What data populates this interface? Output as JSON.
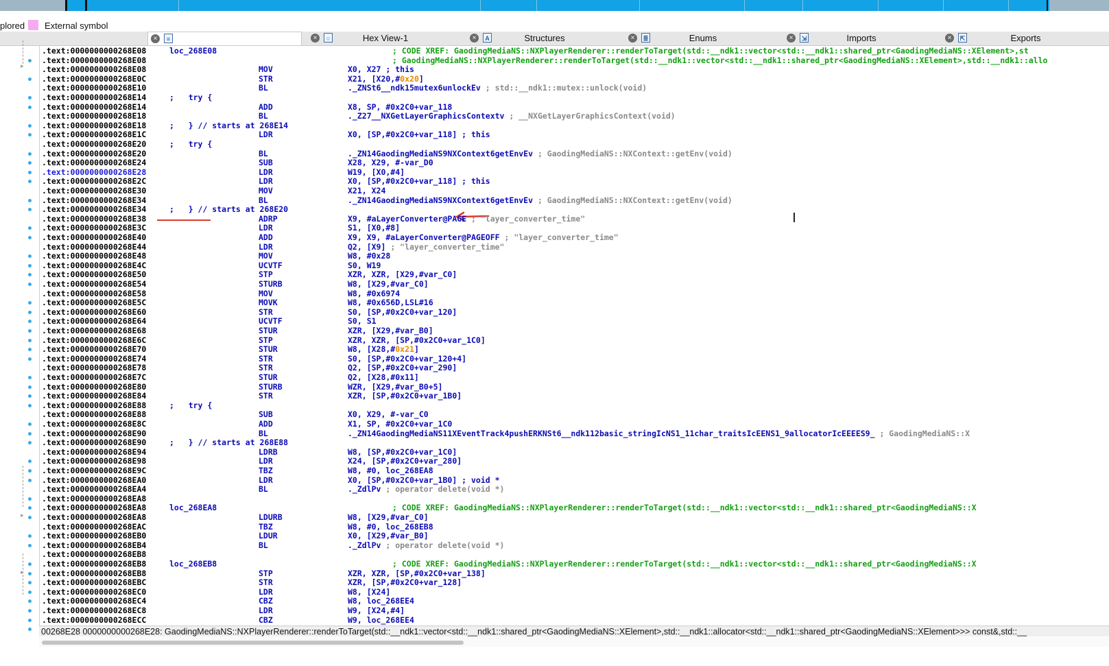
{
  "legend": {
    "explored": "plored",
    "external": "External symbol",
    "external_color": "#f7aaf2"
  },
  "tabs": [
    {
      "name": "tab-ida-view",
      "label": "",
      "icon": "disassembly-icon"
    },
    {
      "name": "tab-hex-view",
      "label": "Hex View-1",
      "icon": "hex-view-icon"
    },
    {
      "name": "tab-structures",
      "label": "Structures",
      "icon": "structures-icon"
    },
    {
      "name": "tab-enums",
      "label": "Enums",
      "icon": "enums-icon"
    },
    {
      "name": "tab-imports",
      "label": "Imports",
      "icon": "imports-icon"
    },
    {
      "name": "tab-exports",
      "label": "Exports",
      "icon": "exports-icon"
    }
  ],
  "colors": {
    "nav_band": "#11a3e6",
    "code_blue": "#0b0bb5",
    "xref_green": "#15a015",
    "comment_gray": "#8a8a8a",
    "highlight_address": "#1d1bd6",
    "annotation_red": "#d93a2e"
  },
  "lines": [
    {
      "addr": ".text:0000000000268E08",
      "label": "loc_268E08",
      "xref": "; CODE XREF: GaodingMediaNS::NXPlayerRenderer::renderToTarget(std::__ndk1::vector<std::__ndk1::shared_ptr<GaodingMediaNS::XElement>,st"
    },
    {
      "addr": ".text:0000000000268E08",
      "xref": "; GaodingMediaNS::NXPlayerRenderer::renderToTarget(std::__ndk1::vector<std::__ndk1::shared_ptr<GaodingMediaNS::XElement>,std::__ndk1::allo"
    },
    {
      "addr": ".text:0000000000268E08",
      "mnem": "MOV",
      "ops": "X0, X27 ; this"
    },
    {
      "addr": ".text:0000000000268E0C",
      "mnem": "STR",
      "ops": "X21, [X20,#",
      "ops_off": "0x20",
      "ops_tail": "]"
    },
    {
      "addr": ".text:0000000000268E10",
      "mnem": "BL",
      "ops": "._ZNSt6__ndk15mutex6unlockEv",
      "cmt": " ; std::__ndk1::mutex::unlock(void)"
    },
    {
      "addr": ".text:0000000000268E14",
      "tryc": ";   try {"
    },
    {
      "addr": ".text:0000000000268E14",
      "mnem": "ADD",
      "ops": "X8, SP, #0x2C0+var_118"
    },
    {
      "addr": ".text:0000000000268E18",
      "mnem": "BL",
      "ops": "._Z27__NXGetLayerGraphicsContextv",
      "cmt": " ; __NXGetLayerGraphicsContext(void)"
    },
    {
      "addr": ".text:0000000000268E18",
      "tryc": ";   } // starts at 268E14"
    },
    {
      "addr": ".text:0000000000268E1C",
      "mnem": "LDR",
      "ops": "X0, [SP,#0x2C0+var_118] ; this"
    },
    {
      "addr": ".text:0000000000268E20",
      "tryc": ";   try {"
    },
    {
      "addr": ".text:0000000000268E20",
      "mnem": "BL",
      "ops": "._ZN14GaodingMediaNS9NXContext6getEnvEv",
      "cmt": " ; GaodingMediaNS::NXContext::getEnv(void)"
    },
    {
      "addr": ".text:0000000000268E24",
      "mnem": "SUB",
      "ops": "X28, X29, #-var_D0"
    },
    {
      "addr": ".text:0000000000268E28",
      "hl": true,
      "mnem": "LDR",
      "ops": "W19, [X0,#4]"
    },
    {
      "addr": ".text:0000000000268E2C",
      "mnem": "LDR",
      "ops": "X0, [SP,#0x2C0+var_118] ; this"
    },
    {
      "addr": ".text:0000000000268E30",
      "mnem": "MOV",
      "ops": "X21, X24"
    },
    {
      "addr": ".text:0000000000268E34",
      "mnem": "BL",
      "ops": "._ZN14GaodingMediaNS9NXContext6getEnvEv",
      "cmt": " ; GaodingMediaNS::NXContext::getEnv(void)"
    },
    {
      "addr": ".text:0000000000268E34",
      "tryc": ";   } // starts at 268E20"
    },
    {
      "addr": ".text:0000000000268E38",
      "mnem": "ADRP",
      "ops": "X9, #aLayerConverter@PAGE",
      "cmt": " ; \"layer_converter_time\""
    },
    {
      "addr": ".text:0000000000268E3C",
      "mnem": "LDR",
      "ops": "S1, [X0,#8]"
    },
    {
      "addr": ".text:0000000000268E40",
      "mnem": "ADD",
      "ops": "X9, X9, #aLayerConverter@PAGEOFF",
      "cmt": " ; \"layer_converter_time\""
    },
    {
      "addr": ".text:0000000000268E44",
      "mnem": "LDR",
      "ops": "Q2, [X9]",
      "cmt": " ; \"layer_converter_time\""
    },
    {
      "addr": ".text:0000000000268E48",
      "mnem": "MOV",
      "ops": "W8, #0x28"
    },
    {
      "addr": ".text:0000000000268E4C",
      "mnem": "UCVTF",
      "ops": "S0, W19"
    },
    {
      "addr": ".text:0000000000268E50",
      "mnem": "STP",
      "ops": "XZR, XZR, [X29,#var_C0]"
    },
    {
      "addr": ".text:0000000000268E54",
      "mnem": "STURB",
      "ops": "W8, [X29,#var_C0]"
    },
    {
      "addr": ".text:0000000000268E58",
      "mnem": "MOV",
      "ops": "W8, #0x6974"
    },
    {
      "addr": ".text:0000000000268E5C",
      "mnem": "MOVK",
      "ops": "W8, #0x656D,LSL#16"
    },
    {
      "addr": ".text:0000000000268E60",
      "mnem": "STR",
      "ops": "S0, [SP,#0x2C0+var_120]"
    },
    {
      "addr": ".text:0000000000268E64",
      "mnem": "UCVTF",
      "ops": "S0, S1"
    },
    {
      "addr": ".text:0000000000268E68",
      "mnem": "STUR",
      "ops": "XZR, [X29,#var_B0]"
    },
    {
      "addr": ".text:0000000000268E6C",
      "mnem": "STP",
      "ops": "XZR, XZR, [SP,#0x2C0+var_1C0]"
    },
    {
      "addr": ".text:0000000000268E70",
      "mnem": "STUR",
      "ops": "W8, [X28,#",
      "ops_off": "0x21",
      "ops_tail": "]"
    },
    {
      "addr": ".text:0000000000268E74",
      "mnem": "STR",
      "ops": "S0, [SP,#0x2C0+var_120+4]"
    },
    {
      "addr": ".text:0000000000268E78",
      "mnem": "STR",
      "ops": "Q2, [SP,#0x2C0+var_290]"
    },
    {
      "addr": ".text:0000000000268E7C",
      "mnem": "STUR",
      "ops": "Q2, [X28,#0x11]"
    },
    {
      "addr": ".text:0000000000268E80",
      "mnem": "STURB",
      "ops": "WZR, [X29,#var_B0+5]"
    },
    {
      "addr": ".text:0000000000268E84",
      "mnem": "STR",
      "ops": "XZR, [SP,#0x2C0+var_1B0]"
    },
    {
      "addr": ".text:0000000000268E88",
      "tryc": ";   try {"
    },
    {
      "addr": ".text:0000000000268E88",
      "mnem": "SUB",
      "ops": "X0, X29, #-var_C0"
    },
    {
      "addr": ".text:0000000000268E8C",
      "mnem": "ADD",
      "ops": "X1, SP, #0x2C0+var_1C0"
    },
    {
      "addr": ".text:0000000000268E90",
      "mnem": "BL",
      "ops": "._ZN14GaodingMediaNS11XEventTrack4pushERKNSt6__ndk112basic_stringIcNS1_11char_traitsIcEENS1_9allocatorIcEEEES9_",
      "cmt": " ; GaodingMediaNS::X"
    },
    {
      "addr": ".text:0000000000268E90",
      "tryc": ";   } // starts at 268E88"
    },
    {
      "addr": ".text:0000000000268E94",
      "mnem": "LDRB",
      "ops": "W8, [SP,#0x2C0+var_1C0]"
    },
    {
      "addr": ".text:0000000000268E98",
      "mnem": "LDR",
      "ops": "X24, [SP,#0x2C0+var_280]"
    },
    {
      "addr": ".text:0000000000268E9C",
      "mnem": "TBZ",
      "ops": "W8, #0, loc_268EA8"
    },
    {
      "addr": ".text:0000000000268EA0",
      "mnem": "LDR",
      "ops": "X0, [SP,#0x2C0+var_1B0] ; void *"
    },
    {
      "addr": ".text:0000000000268EA4",
      "mnem": "BL",
      "ops": "._ZdlPv",
      "cmt": " ; operator delete(void *)"
    },
    {
      "addr": ".text:0000000000268EA8"
    },
    {
      "addr": ".text:0000000000268EA8",
      "label": "loc_268EA8",
      "xref": "; CODE XREF: GaodingMediaNS::NXPlayerRenderer::renderToTarget(std::__ndk1::vector<std::__ndk1::shared_ptr<GaodingMediaNS::X"
    },
    {
      "addr": ".text:0000000000268EA8",
      "mnem": "LDURB",
      "ops": "W8, [X29,#var_C0]"
    },
    {
      "addr": ".text:0000000000268EAC",
      "mnem": "TBZ",
      "ops": "W8, #0, loc_268EB8"
    },
    {
      "addr": ".text:0000000000268EB0",
      "mnem": "LDUR",
      "ops": "X0, [X29,#var_B0]"
    },
    {
      "addr": ".text:0000000000268EB4",
      "mnem": "BL",
      "ops": "._ZdlPv",
      "cmt": " ; operator delete(void *)"
    },
    {
      "addr": ".text:0000000000268EB8"
    },
    {
      "addr": ".text:0000000000268EB8",
      "label": "loc_268EB8",
      "xref": "; CODE XREF: GaodingMediaNS::NXPlayerRenderer::renderToTarget(std::__ndk1::vector<std::__ndk1::shared_ptr<GaodingMediaNS::X"
    },
    {
      "addr": ".text:0000000000268EB8",
      "mnem": "STP",
      "ops": "XZR, XZR, [SP,#0x2C0+var_138]"
    },
    {
      "addr": ".text:0000000000268EBC",
      "mnem": "STR",
      "ops": "XZR, [SP,#0x2C0+var_128]"
    },
    {
      "addr": ".text:0000000000268EC0",
      "mnem": "LDR",
      "ops": "W8, [X24]"
    },
    {
      "addr": ".text:0000000000268EC4",
      "mnem": "CBZ",
      "ops": "W8, loc_268EE4"
    },
    {
      "addr": ".text:0000000000268EC8",
      "mnem": "LDR",
      "ops": "W9, [X24,#4]"
    },
    {
      "addr": ".text:0000000000268ECC",
      "mnem": "CBZ",
      "ops": "W9, loc_268EE4"
    }
  ],
  "status": {
    "text": "00268E28 0000000000268E28: GaodingMediaNS::NXPlayerRenderer::renderToTarget(std::__ndk1::vector<std::__ndk1::shared_ptr<GaodingMediaNS::XElement>,std::__ndk1::allocator<std::__ndk1::shared_ptr<GaodingMediaNS::XElement>>> const&,std::__"
  }
}
